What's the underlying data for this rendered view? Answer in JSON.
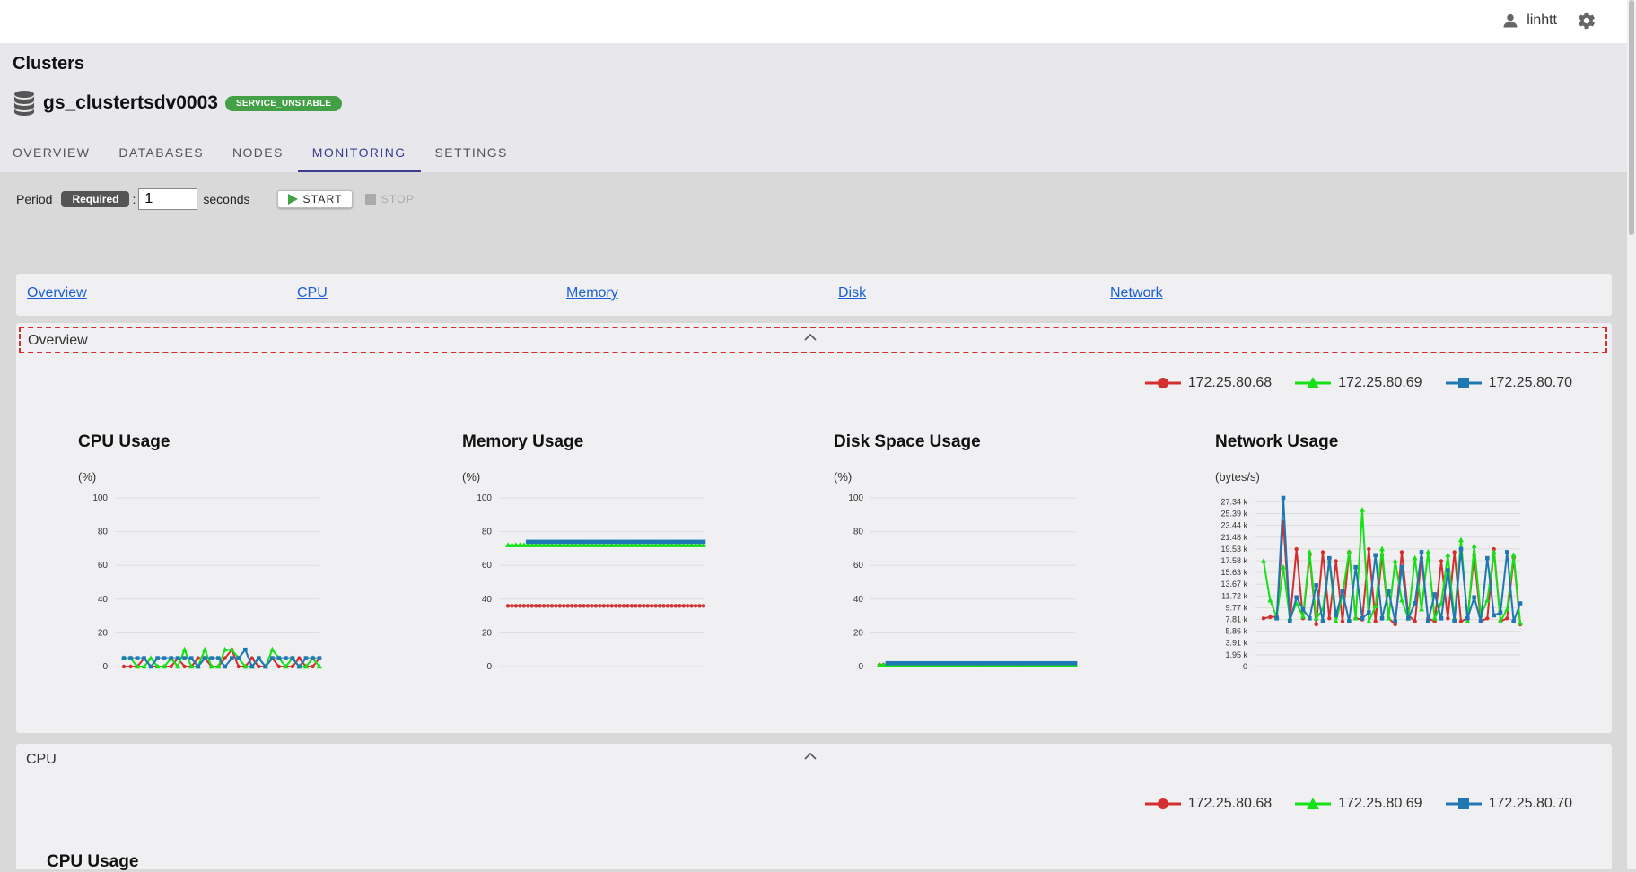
{
  "user": {
    "name": "linhtt",
    "user_icon": "person-icon",
    "settings_icon": "gear-icon"
  },
  "page": {
    "title": "Clusters"
  },
  "cluster": {
    "name": "gs_clustertsdv0003",
    "status": "SERVICE_UNSTABLE",
    "icon": "database-icon"
  },
  "tabs": [
    {
      "label": "OVERVIEW"
    },
    {
      "label": "DATABASES"
    },
    {
      "label": "NODES"
    },
    {
      "label": "MONITORING",
      "active": true
    },
    {
      "label": "SETTINGS"
    }
  ],
  "controls": {
    "period_label": "Period",
    "required_badge": "Required",
    "colon": ":",
    "period_value": "1",
    "unit_label": "seconds",
    "start_label": "START",
    "stop_label": "STOP"
  },
  "nav_links": [
    {
      "label": "Overview"
    },
    {
      "label": "CPU"
    },
    {
      "label": "Memory"
    },
    {
      "label": "Disk"
    },
    {
      "label": "Network"
    }
  ],
  "sections": {
    "overview": {
      "title": "Overview",
      "expanded": true
    },
    "cpu": {
      "title": "CPU",
      "expanded": true,
      "chart_title": "CPU Usage"
    }
  },
  "legend": [
    {
      "name": "172.25.80.68",
      "color": "#d32f2f",
      "marker": "circle"
    },
    {
      "name": "172.25.80.69",
      "color": "#16e016",
      "marker": "triangle"
    },
    {
      "name": "172.25.80.70",
      "color": "#1f77b4",
      "marker": "square"
    }
  ],
  "chart_data": [
    {
      "type": "line",
      "title": "CPU Usage",
      "ylabel": "(%)",
      "ylim": [
        0,
        100
      ],
      "yticks": [
        "0",
        "20",
        "40",
        "60",
        "80",
        "100"
      ],
      "grid": true,
      "series": [
        {
          "name": "172.25.80.68",
          "values": [
            0,
            0,
            0,
            5,
            0,
            0,
            0,
            0,
            5,
            0,
            0,
            5,
            5,
            0,
            0,
            5,
            10,
            0,
            0,
            5,
            0,
            0,
            5,
            0,
            0,
            0,
            5,
            0,
            0,
            5
          ]
        },
        {
          "name": "172.25.80.69",
          "values": [
            5,
            5,
            0,
            0,
            5,
            0,
            0,
            5,
            0,
            10,
            0,
            0,
            10,
            0,
            0,
            10,
            10,
            5,
            0,
            0,
            5,
            0,
            10,
            5,
            0,
            5,
            0,
            0,
            5,
            0
          ]
        },
        {
          "name": "172.25.80.70",
          "values": [
            5,
            5,
            5,
            5,
            0,
            5,
            5,
            5,
            5,
            5,
            5,
            0,
            5,
            5,
            5,
            0,
            5,
            5,
            10,
            0,
            5,
            0,
            5,
            5,
            5,
            5,
            0,
            5,
            5,
            5
          ]
        }
      ]
    },
    {
      "type": "line",
      "title": "Memory Usage",
      "ylabel": "(%)",
      "ylim": [
        0,
        100
      ],
      "yticks": [
        "0",
        "20",
        "40",
        "60",
        "80",
        "100"
      ],
      "grid": true,
      "series": [
        {
          "name": "172.25.80.68",
          "values": [
            36,
            36,
            36,
            36,
            36,
            36,
            36,
            36,
            36,
            36,
            36,
            36,
            36,
            36,
            36,
            36,
            36,
            36,
            36,
            36,
            36,
            36,
            36,
            36,
            36,
            36,
            36,
            36,
            36,
            36,
            36,
            36,
            36,
            36,
            36,
            36,
            36,
            36,
            36,
            36,
            36,
            36,
            36,
            36,
            36,
            36,
            36,
            36,
            36,
            36
          ]
        },
        {
          "name": "172.25.80.69",
          "values": [
            72,
            72,
            72,
            72,
            72,
            72,
            72,
            72,
            72,
            72,
            72,
            72,
            72,
            72,
            72,
            72,
            72,
            72,
            72,
            72,
            72,
            72,
            72,
            72,
            72,
            72,
            72,
            72,
            72,
            72,
            72,
            72,
            72,
            72,
            72,
            72,
            72,
            72,
            72,
            72,
            72,
            72,
            72,
            72,
            72,
            72,
            72,
            72,
            72,
            72
          ]
        },
        {
          "name": "172.25.80.70",
          "values": [
            null,
            null,
            null,
            null,
            null,
            74,
            74,
            74,
            74,
            74,
            74,
            74,
            74,
            74,
            74,
            74,
            74,
            74,
            74,
            74,
            74,
            74,
            74,
            74,
            74,
            74,
            74,
            74,
            74,
            74,
            74,
            74,
            74,
            74,
            74,
            74,
            74,
            74,
            74,
            74,
            74,
            74,
            74,
            74,
            74,
            74,
            74,
            74,
            74,
            74
          ]
        }
      ]
    },
    {
      "type": "line",
      "title": "Disk Space Usage",
      "ylabel": "(%)",
      "ylim": [
        0,
        100
      ],
      "yticks": [
        "0",
        "20",
        "40",
        "60",
        "80",
        "100"
      ],
      "grid": true,
      "series": [
        {
          "name": "172.25.80.68",
          "values": [
            1,
            1,
            1,
            1,
            1,
            1,
            1,
            1,
            1,
            1,
            1,
            1,
            1,
            1,
            1,
            1,
            1,
            1,
            1,
            1,
            1,
            1,
            1,
            1,
            1,
            1,
            1,
            1,
            1,
            1,
            1,
            1,
            1,
            1,
            1,
            1,
            1,
            1,
            1,
            1,
            1,
            1,
            1,
            1,
            1,
            1,
            1,
            1,
            1,
            1
          ]
        },
        {
          "name": "172.25.80.69",
          "values": [
            1,
            1,
            1,
            1,
            1,
            1,
            1,
            1,
            1,
            1,
            1,
            1,
            1,
            1,
            1,
            1,
            1,
            1,
            1,
            1,
            1,
            1,
            1,
            1,
            1,
            1,
            1,
            1,
            1,
            1,
            1,
            1,
            1,
            1,
            1,
            1,
            1,
            1,
            1,
            1,
            1,
            1,
            1,
            1,
            1,
            1,
            1,
            1,
            1,
            1
          ]
        },
        {
          "name": "172.25.80.70",
          "values": [
            null,
            null,
            2,
            2,
            2,
            2,
            2,
            2,
            2,
            2,
            2,
            2,
            2,
            2,
            2,
            2,
            2,
            2,
            2,
            2,
            2,
            2,
            2,
            2,
            2,
            2,
            2,
            2,
            2,
            2,
            2,
            2,
            2,
            2,
            2,
            2,
            2,
            2,
            2,
            2,
            2,
            2,
            2,
            2,
            2,
            2,
            2,
            2,
            2,
            2
          ]
        }
      ]
    },
    {
      "type": "line",
      "title": "Network Usage",
      "ylabel": "(bytes/s)",
      "ylim": [
        0,
        28000
      ],
      "yticks": [
        "0",
        "1.95 k",
        "3.91 k",
        "5.86 k",
        "7.81 k",
        "9.77 k",
        "11.72 k",
        "13.67 k",
        "15.63 k",
        "17.58 k",
        "19.53 k",
        "21.48 k",
        "23.44 k",
        "25.39 k",
        "27.34 k"
      ],
      "grid": true,
      "series": [
        {
          "name": "172.25.80.68",
          "values": [
            8000,
            8200,
            8300,
            24000,
            7500,
            19500,
            8000,
            18500,
            7000,
            19000,
            8000,
            17500,
            7500,
            19000,
            8000,
            7800,
            19500,
            7500,
            18500,
            8000,
            7000,
            19000,
            8500,
            7500,
            18000,
            8000,
            7500,
            17500,
            8000,
            19000,
            7500,
            8000,
            18500,
            7500,
            8000,
            19500,
            7500,
            8000,
            18000,
            7000
          ]
        },
        {
          "name": "172.25.80.69",
          "values": [
            17500,
            11000,
            8200,
            16500,
            8000,
            10500,
            8300,
            19000,
            8000,
            9500,
            17500,
            7500,
            12000,
            19000,
            8000,
            26000,
            7500,
            10000,
            19500,
            8000,
            17500,
            11000,
            8000,
            18000,
            9500,
            19000,
            8000,
            10500,
            18500,
            8000,
            21000,
            7500,
            20000,
            8500,
            11000,
            19000,
            7500,
            9500,
            18500,
            7200
          ]
        },
        {
          "name": "172.25.80.70",
          "values": [
            null,
            null,
            8000,
            28000,
            7500,
            11500,
            9500,
            8000,
            13500,
            7500,
            18000,
            8500,
            12500,
            7500,
            16500,
            8000,
            9000,
            18500,
            8000,
            12500,
            7500,
            16500,
            8000,
            10500,
            19000,
            7500,
            12000,
            8000,
            16000,
            7500,
            19500,
            8000,
            11500,
            7500,
            18000,
            8500,
            9000,
            19000,
            7500,
            10500
          ]
        }
      ]
    },
    {
      "type": "line",
      "title": "CPU Usage",
      "ylabel": "",
      "series": []
    }
  ],
  "colors": {
    "accent": "#3b3b8f",
    "status_green": "#43a047",
    "link": "#1a5fd6",
    "focus_border": "#d32f2f"
  }
}
